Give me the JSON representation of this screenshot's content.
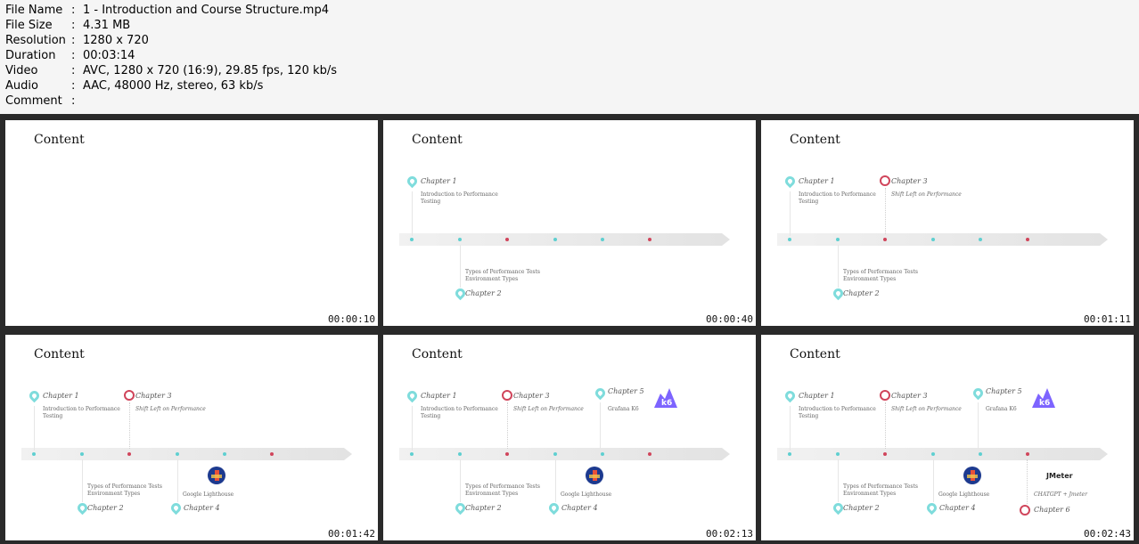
{
  "info": {
    "rows": [
      {
        "key": "File Name",
        "value": "1 - Introduction and Course Structure.mp4"
      },
      {
        "key": "File Size",
        "value": "4.31 MB"
      },
      {
        "key": "Resolution",
        "value": "1280 x 720"
      },
      {
        "key": "Duration",
        "value": "00:03:14"
      },
      {
        "key": "Video",
        "value": "AVC, 1280 x 720 (16:9), 29.85 fps, 120 kb/s"
      },
      {
        "key": "Audio",
        "value": "AAC, 48000 Hz, stereo, 63 kb/s"
      },
      {
        "key": "Comment",
        "value": ""
      }
    ],
    "separator": ":"
  },
  "slide": {
    "title": "Content",
    "ch1": "Chapter 1",
    "ch1_sub": "Introduction to Performance\nTesting",
    "ch2": "Chapter 2",
    "ch2_sub": "Types of Performance Tests\nEnvironment Types",
    "ch3": "Chapter 3",
    "ch3_sub": "Shift Left on Performance",
    "ch4": "Chapter 4",
    "ch4_sub": "Google Lighthouse",
    "ch5": "Chapter 5",
    "ch5_sub": "Grafana K6",
    "ch6": "Chapter 6",
    "ch6_sub": "CHATGPT + Jmeter",
    "k6_label": "k6",
    "jmeter_label": "JMeter"
  },
  "thumbs": [
    {
      "timestamp": "00:00:10",
      "chapters": []
    },
    {
      "timestamp": "00:00:40",
      "chapters": [
        1,
        2
      ]
    },
    {
      "timestamp": "00:01:11",
      "chapters": [
        1,
        2,
        3
      ]
    },
    {
      "timestamp": "00:01:42",
      "chapters": [
        1,
        2,
        3,
        4
      ]
    },
    {
      "timestamp": "00:02:13",
      "chapters": [
        1,
        2,
        3,
        4,
        5
      ]
    },
    {
      "timestamp": "00:02:43",
      "chapters": [
        1,
        2,
        3,
        4,
        5,
        6
      ]
    }
  ],
  "colors": {
    "teal": "#5ecfd0",
    "red": "#d0455b",
    "k6": "#7d64ff"
  }
}
